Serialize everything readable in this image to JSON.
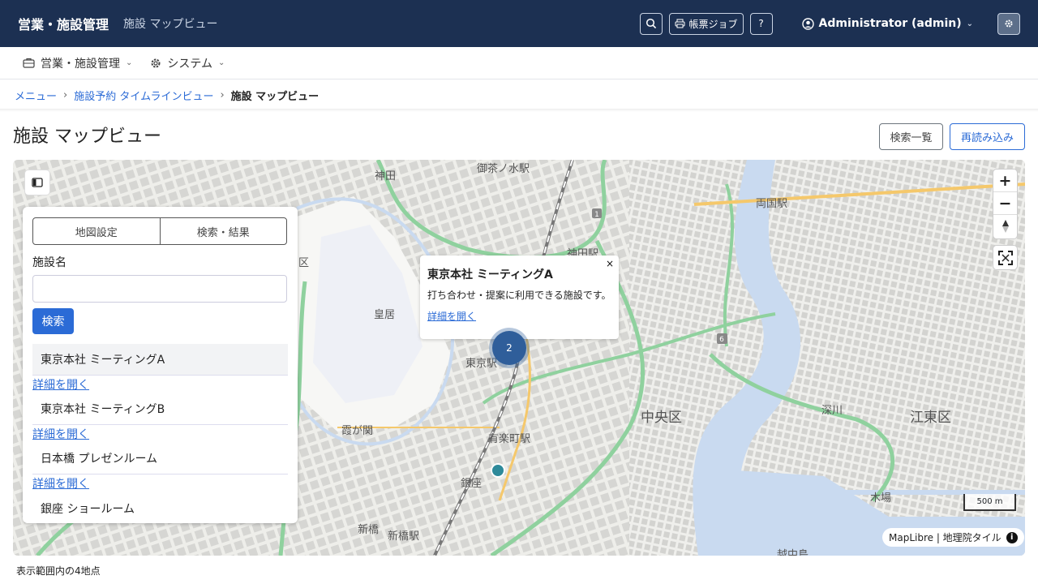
{
  "header": {
    "brand": "営業・施設管理",
    "subtitle": "施設 マップビュー",
    "print_jobs_label": "帳票ジョブ",
    "help_label": "?",
    "user_label": "Administrator (admin)"
  },
  "menu": {
    "items": [
      {
        "label": "営業・施設管理",
        "icon": "briefcase-icon"
      },
      {
        "label": "システム",
        "icon": "gear-icon"
      }
    ]
  },
  "breadcrumb": {
    "items": [
      "メニュー",
      "施設予約 タイムラインビュー"
    ],
    "separator": "›",
    "current": "施設 マップビュー"
  },
  "page": {
    "title": "施設 マップビュー",
    "list_button": "検索一覧",
    "reload_button": "再読み込み"
  },
  "panel": {
    "tabs": [
      "地図設定",
      "検索・結果"
    ],
    "field_label": "施設名",
    "field_value": "",
    "search_button": "検索",
    "detail_link": "詳細を開く",
    "results": [
      {
        "name": "東京本社 ミーティングA",
        "active": true
      },
      {
        "name": "東京本社 ミーティングB",
        "active": false
      },
      {
        "name": "日本橋 プレゼンルーム",
        "active": false
      },
      {
        "name": "銀座 ショールーム",
        "active": false
      }
    ]
  },
  "map": {
    "labels": {
      "kanda": "神田",
      "ochanomizu": "御茶ノ水駅",
      "kanda_st": "神田駅",
      "ryogoku": "両国駅",
      "kokyo": "皇居",
      "tokyo_st": "東京駅",
      "chuo": "中央区",
      "koto": "江東区",
      "yurakucho": "有楽町駅",
      "kasumigaseki": "霞が関",
      "ginza": "銀座",
      "shinbashi": "新橋",
      "shinbashi_st": "新橋駅",
      "fukagawa": "深川",
      "kiba": "木場",
      "tsukishima": "越中島",
      "ku": "区"
    },
    "popup": {
      "title": "東京本社 ミーティングA",
      "description": "打ち合わせ・提案に利用できる施設です。",
      "link": "詳細を開く",
      "close": "×"
    },
    "cluster_count": "2",
    "scale_label": "500 m",
    "attribution": "MapLibre | 地理院タイル",
    "route_badges": [
      "1",
      "6"
    ],
    "colors": {
      "water": "#c9daf0",
      "road": "#8fd19e",
      "major_road": "#f5c86b",
      "rail": "#777777"
    }
  },
  "status": {
    "visible_count": "表示範囲内の4地点"
  }
}
